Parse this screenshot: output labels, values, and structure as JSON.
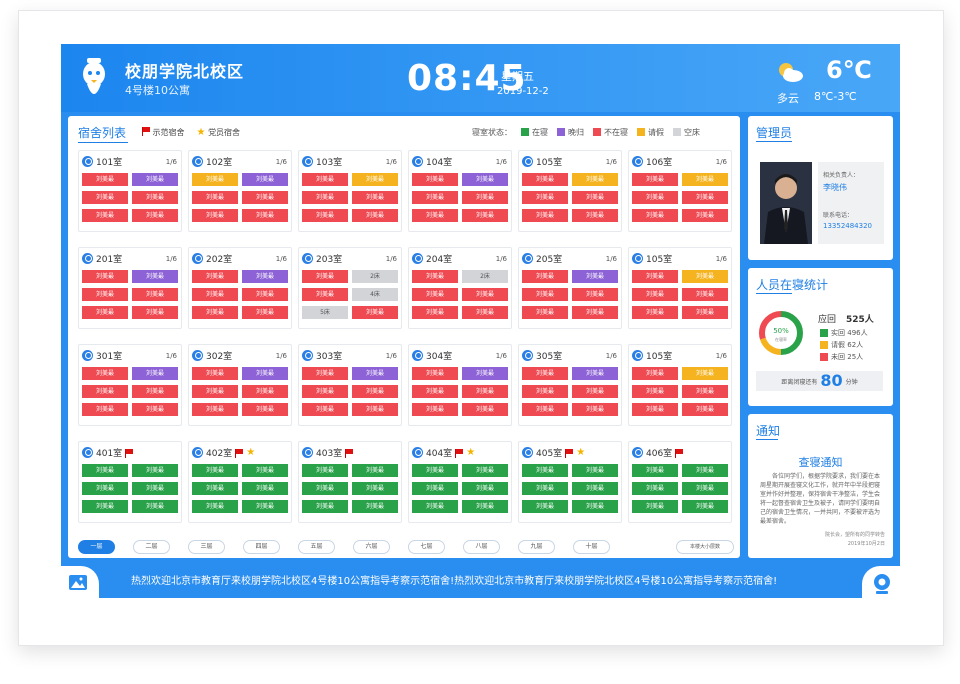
{
  "header": {
    "school": "校朋学院北校区",
    "building": "4号楼10公寓",
    "time": "08:45",
    "weekday": "星期五",
    "date": "2019-12-2",
    "weather": {
      "icon": "partly-cloudy-icon",
      "desc": "多云",
      "temp": "6℃",
      "range": "8℃-3℃"
    }
  },
  "main": {
    "title": "宿舍列表",
    "legend_flags": [
      {
        "icon": "red-flag-icon",
        "label": "示范宿舍"
      },
      {
        "icon": "star-icon",
        "label": "党员宿舍"
      }
    ],
    "status_label": "寝室状态：",
    "statuses": [
      {
        "label": "在寝",
        "color": "#2aa24a"
      },
      {
        "label": "晚归",
        "color": "#8d62d6"
      },
      {
        "label": "不在寝",
        "color": "#ef4a52"
      },
      {
        "label": "请假",
        "color": "#f5b320"
      },
      {
        "label": "空床",
        "color": "#d2d4d8"
      }
    ]
  },
  "bed_label": "刘美最",
  "rooms": [
    {
      "name": "101室",
      "count": "1/6",
      "flag": false,
      "star": false,
      "beds": [
        "red",
        "purple",
        "red",
        "red",
        "red",
        "red"
      ]
    },
    {
      "name": "102室",
      "count": "1/6",
      "flag": false,
      "star": false,
      "beds": [
        "yellow",
        "purple",
        "red",
        "red",
        "red",
        "red"
      ]
    },
    {
      "name": "103室",
      "count": "1/6",
      "flag": false,
      "star": false,
      "beds": [
        "red",
        "yellow",
        "red",
        "red",
        "red",
        "red"
      ]
    },
    {
      "name": "104室",
      "count": "1/6",
      "flag": false,
      "star": false,
      "beds": [
        "red",
        "purple",
        "red",
        "red",
        "red",
        "red"
      ]
    },
    {
      "name": "105室",
      "count": "1/6",
      "flag": false,
      "star": false,
      "beds": [
        "red",
        "yellow",
        "red",
        "red",
        "red",
        "red"
      ]
    },
    {
      "name": "106室",
      "count": "1/6",
      "flag": false,
      "star": false,
      "beds": [
        "red",
        "yellow",
        "red",
        "red",
        "red",
        "red"
      ]
    },
    {
      "name": "201室",
      "count": "1/6",
      "flag": false,
      "star": false,
      "beds": [
        "red",
        "purple",
        "red",
        "red",
        "red",
        "red"
      ]
    },
    {
      "name": "202室",
      "count": "1/6",
      "flag": false,
      "star": false,
      "beds": [
        "red",
        "purple",
        "red",
        "red",
        "red",
        "red"
      ]
    },
    {
      "name": "203室",
      "count": "1/6",
      "flag": false,
      "star": false,
      "beds": [
        "red",
        "gray:2床",
        "red",
        "gray:4床",
        "gray:5床",
        "red"
      ]
    },
    {
      "name": "204室",
      "count": "1/6",
      "flag": false,
      "star": false,
      "beds": [
        "red",
        "gray:2床",
        "red",
        "red",
        "red",
        "red"
      ]
    },
    {
      "name": "205室",
      "count": "1/6",
      "flag": false,
      "star": false,
      "beds": [
        "red",
        "purple",
        "red",
        "red",
        "red",
        "red"
      ]
    },
    {
      "name": "105室",
      "count": "1/6",
      "flag": false,
      "star": false,
      "beds": [
        "red",
        "yellow",
        "red",
        "red",
        "red",
        "red"
      ]
    },
    {
      "name": "301室",
      "count": "1/6",
      "flag": false,
      "star": false,
      "beds": [
        "red",
        "purple",
        "red",
        "red",
        "red",
        "red"
      ]
    },
    {
      "name": "302室",
      "count": "1/6",
      "flag": false,
      "star": false,
      "beds": [
        "red",
        "purple",
        "red",
        "red",
        "red",
        "red"
      ]
    },
    {
      "name": "303室",
      "count": "1/6",
      "flag": false,
      "star": false,
      "beds": [
        "red",
        "purple",
        "red",
        "red",
        "red",
        "red"
      ]
    },
    {
      "name": "304室",
      "count": "1/6",
      "flag": false,
      "star": false,
      "beds": [
        "red",
        "purple",
        "red",
        "red",
        "red",
        "red"
      ]
    },
    {
      "name": "305室",
      "count": "1/6",
      "flag": false,
      "star": false,
      "beds": [
        "red",
        "purple",
        "red",
        "red",
        "red",
        "red"
      ]
    },
    {
      "name": "105室",
      "count": "1/6",
      "flag": false,
      "star": false,
      "beds": [
        "red",
        "yellow",
        "red",
        "red",
        "red",
        "red"
      ]
    },
    {
      "name": "401室",
      "count": "",
      "flag": true,
      "star": false,
      "beds": [
        "green",
        "green",
        "green",
        "green",
        "green",
        "green"
      ]
    },
    {
      "name": "402室",
      "count": "",
      "flag": true,
      "star": true,
      "beds": [
        "green",
        "green",
        "green",
        "green",
        "green",
        "green"
      ]
    },
    {
      "name": "403室",
      "count": "",
      "flag": true,
      "star": false,
      "beds": [
        "green",
        "green",
        "green",
        "green",
        "green",
        "green"
      ]
    },
    {
      "name": "404室",
      "count": "",
      "flag": true,
      "star": true,
      "beds": [
        "green",
        "green",
        "green",
        "green",
        "green",
        "green"
      ]
    },
    {
      "name": "405室",
      "count": "",
      "flag": true,
      "star": true,
      "beds": [
        "green",
        "green",
        "green",
        "green",
        "green",
        "green"
      ]
    },
    {
      "name": "406室",
      "count": "",
      "flag": true,
      "star": false,
      "beds": [
        "green",
        "green",
        "green",
        "green",
        "green",
        "green"
      ]
    }
  ],
  "bed_colors": {
    "red": "#ef4a52",
    "purple": "#8d62d6",
    "yellow": "#f5b320",
    "green": "#2aa24a",
    "gray": "#d2d4d8"
  },
  "pager": {
    "pages": [
      "一层",
      "二层",
      "三层",
      "四层",
      "五层",
      "六层",
      "七层",
      "八层",
      "九层",
      "十层"
    ],
    "active_index": 0,
    "next_label": "本楼大小层数"
  },
  "admin": {
    "title": "管理员",
    "role_label": "相关负责人：",
    "name": "李晓伟",
    "phone_label": "联系电话：",
    "phone": "13352484320",
    "photo_icon": "manager-photo"
  },
  "stats": {
    "title": "人员在寝统计",
    "percent": "50%",
    "donut_sub": "在寝率",
    "total_label": "应回",
    "total": "525人",
    "rows": [
      {
        "label": "实回",
        "value": "496人",
        "color": "#2aa24a",
        "fraction": 0.5
      },
      {
        "label": "请假",
        "value": "62人",
        "color": "#f5b320",
        "fraction": 0.2
      },
      {
        "label": "未回",
        "value": "25人",
        "color": "#ef4a52",
        "fraction": 0.3
      }
    ],
    "return_prefix": "距离闭寝还有",
    "return_value": "80",
    "return_unit": "分钟"
  },
  "notice": {
    "title": "通知",
    "heading": "查寝通知",
    "body": "各位同学们，根据学院要求，我们要在本周星期开展查寝文化工作，就开年中半段把寝室并作好并整理，保持宿舍干净整洁，学生会将一起督查宿舍卫生及被子，请同学们要明自己的宿舍卫生情况，一并共同，不要被评选为最差宿舍。",
    "signer": "院长会，望所有的同学转告",
    "sign_date": "2019年10月2日"
  },
  "ticker": "热烈欢迎北京市教育厅来校朋学院北校区4号楼10公寓指导考察示范宿舍!热烈欢迎北京市教育厅来校朋学院北校区4号楼10公寓指导考察示范宿舍!",
  "icons": {
    "album": "image-album-icon",
    "camera": "camera-icon"
  }
}
